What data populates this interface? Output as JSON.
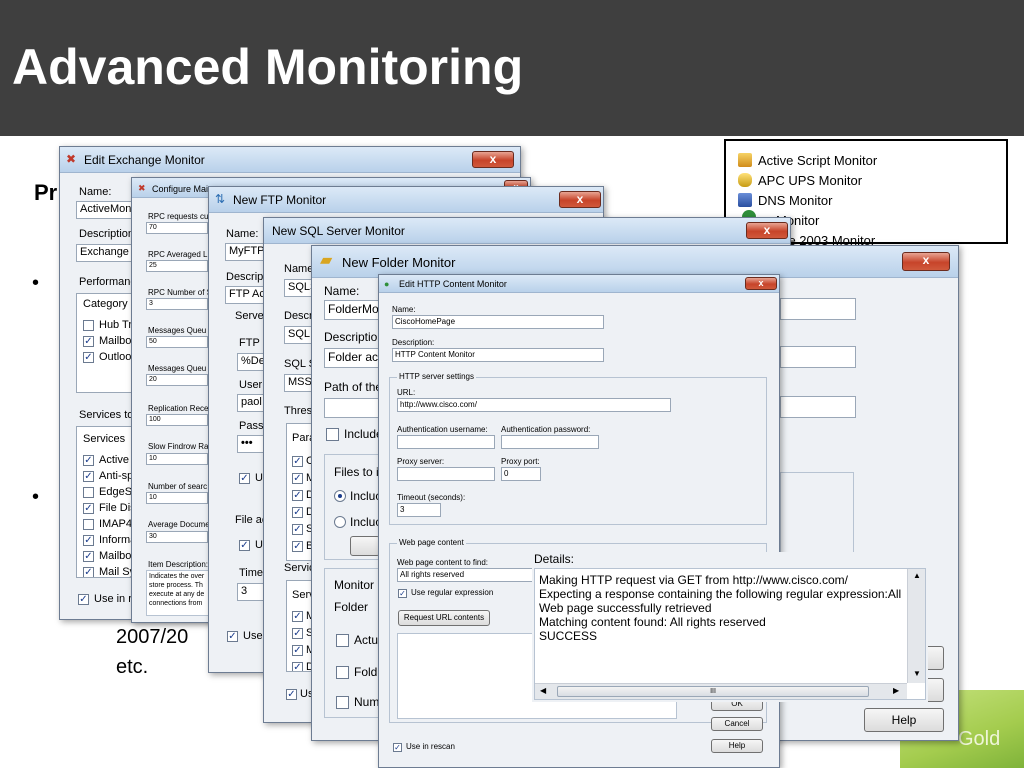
{
  "slide": {
    "title": "Advanced Monitoring",
    "heading_fragment": "Pr",
    "bullet": "•",
    "text_fragment_1": "2007/20",
    "text_fragment_2": "etc.",
    "logo_fragment": "Gold"
  },
  "monitor_list": {
    "items": [
      "Active Script Monitor",
      "APC UPS Monitor",
      "DNS Monitor",
      "Email Monitor",
      "Exchange 2003 Monitor"
    ],
    "visible_items": [
      "Active Script Monitor",
      "APC UPS Monitor",
      "DNS Monitor",
      "Monitor",
      "nge 2003 Monitor"
    ]
  },
  "exchange": {
    "title": "Edit Exchange Monitor",
    "name_label": "Name:",
    "name_value": "ActiveMonit",
    "description_label": "Description",
    "description_value": "Exchange a",
    "performance_label": "Performanc",
    "category_header": "Category",
    "categories": [
      {
        "label": "Hub Tr",
        "checked": false
      },
      {
        "label": "Mailbo",
        "checked": true
      },
      {
        "label": "Outloo",
        "checked": true
      }
    ],
    "services_label": "Services to",
    "services_header": "Services",
    "services": [
      {
        "label": "Active",
        "checked": true
      },
      {
        "label": "Anti-sp",
        "checked": true
      },
      {
        "label": "EdgeS",
        "checked": false
      },
      {
        "label": "File Dis",
        "checked": true
      },
      {
        "label": "IMAP4",
        "checked": false
      },
      {
        "label": "Informa",
        "checked": true
      },
      {
        "label": "Mailbo",
        "checked": true
      },
      {
        "label": "Mail Sy",
        "checked": true
      }
    ],
    "use_in_rescan": "Use in r"
  },
  "mailbox": {
    "title": "Configure Mai",
    "fields": [
      {
        "label": "RPC requests cu",
        "value": "70"
      },
      {
        "label": "RPC Averaged L",
        "value": "25"
      },
      {
        "label": "RPC Number of S",
        "value": "3"
      },
      {
        "label": "Messages Queu",
        "value": "50"
      },
      {
        "label": "Messages Queu",
        "value": "20"
      },
      {
        "label": "Replication Rece",
        "value": "100"
      },
      {
        "label": "Slow Findrow Ra",
        "value": "10"
      },
      {
        "label": "Number of searc",
        "value": "10"
      },
      {
        "label": "Average Docume",
        "value": "30"
      }
    ],
    "item_description_label": "Item Description:",
    "item_description": [
      "Indicates the over",
      "store process.  Th",
      "execute at any de",
      "connections from"
    ]
  },
  "ftp": {
    "title": "New FTP Monitor",
    "name_label": "Name:",
    "name_value": "MyFTPI",
    "description_label": "Descript",
    "description_value": "FTP Act",
    "server_label": "Server",
    "ftp_label": "FTP s",
    "ftp_value": "%De",
    "user_label": "User",
    "user_value": "paol",
    "password_label": "Pass",
    "password_value": "•••",
    "use_label": "U",
    "file_label": "File ac",
    "file_use_label": "U",
    "timeout_label": "Time",
    "timeout_value": "3",
    "use_in_rescan": "Use"
  },
  "sql": {
    "title": "New SQL Server Monitor",
    "name_label": "Name:",
    "name_value": "SQLS",
    "description_label": "Descri",
    "description_value": "SQL S",
    "server_label": "SQL Se",
    "server_value": "MSSC",
    "thresholds_label": "Thresh",
    "params_header": "Para",
    "params": [
      "C",
      "M",
      "D",
      "D",
      "S",
      "B"
    ],
    "service_label": "Servic",
    "service_header": "Serv",
    "services": [
      "M",
      "S",
      "M",
      "D"
    ],
    "use_in_rescan": "Us"
  },
  "folder": {
    "title": "New Folder Monitor",
    "name_label": "Name:",
    "name_value": "FolderMon",
    "description_label": "Descriptio",
    "description_value": "Folder act",
    "path_label": "Path of the",
    "include_label": "Include",
    "files_label": "Files to ir",
    "radio_1": "Incluc",
    "radio_2": "Incluc",
    "monitor_label": "Monitor i",
    "folder_label": "Folder",
    "checks": [
      "Actu",
      "Fold",
      "Num"
    ],
    "help": "Help"
  },
  "http": {
    "title": "Edit HTTP Content Monitor",
    "name_label": "Name:",
    "name_value": "CiscoHomePage",
    "description_label": "Description:",
    "description_value": "HTTP Content Monitor",
    "settings_label": "HTTP server settings",
    "url_label": "URL:",
    "url_value": "http://www.cisco.com/",
    "auth_user_label": "Authentication username:",
    "auth_pass_label": "Authentication password:",
    "proxy_label": "Proxy server:",
    "proxy_port_label": "Proxy port:",
    "proxy_port_value": "0",
    "timeout_label": "Timeout (seconds):",
    "timeout_value": "3",
    "web_content_label": "Web page content",
    "find_label": "Web page content to find:",
    "find_value": "All rights reserved",
    "regex_label": "Use regular expression",
    "request_button": "Request URL contents",
    "ok_button": "OK",
    "cancel_button": "Cancel",
    "help_button": "Help",
    "rescan_label": "Use in rescan"
  },
  "details": {
    "label": "Details:",
    "lines": [
      "Making HTTP request via GET from http://www.cisco.com/",
      "Expecting a response containing the following regular expression:All ri",
      "Web page successfully retrieved",
      "Matching content found: All rights reserved",
      "SUCCESS"
    ],
    "scroll_grip": "III"
  }
}
